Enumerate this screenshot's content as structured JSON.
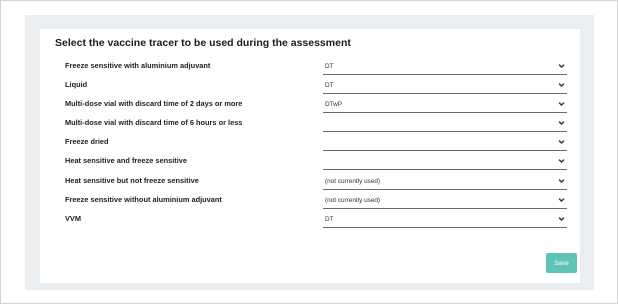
{
  "page": {
    "title": "Select the vaccine tracer to be used during the assessment",
    "save_label": "Save",
    "accent_color": "#5ec4b3"
  },
  "rows": [
    {
      "label": "Freeze sensitive with aluminium adjuvant",
      "value": "DT"
    },
    {
      "label": "Liquid",
      "value": "DT"
    },
    {
      "label": "Multi-dose vial with discard time of 2 days or more",
      "value": "DTwP"
    },
    {
      "label": "Multi-dose vial with discard time of 6 hours or less",
      "value": ""
    },
    {
      "label": "Freeze dried",
      "value": ""
    },
    {
      "label": "Heat sensitive and freeze sensitive",
      "value": ""
    },
    {
      "label": "Heat sensitive but not freeze sensitive",
      "value": "(not currently used)"
    },
    {
      "label": "Freeze sensitive without aluminium adjuvant",
      "value": "(not currently used)"
    },
    {
      "label": "VVM",
      "value": "DT"
    }
  ],
  "icons": {
    "dropdown": "chevron-down-icon"
  }
}
